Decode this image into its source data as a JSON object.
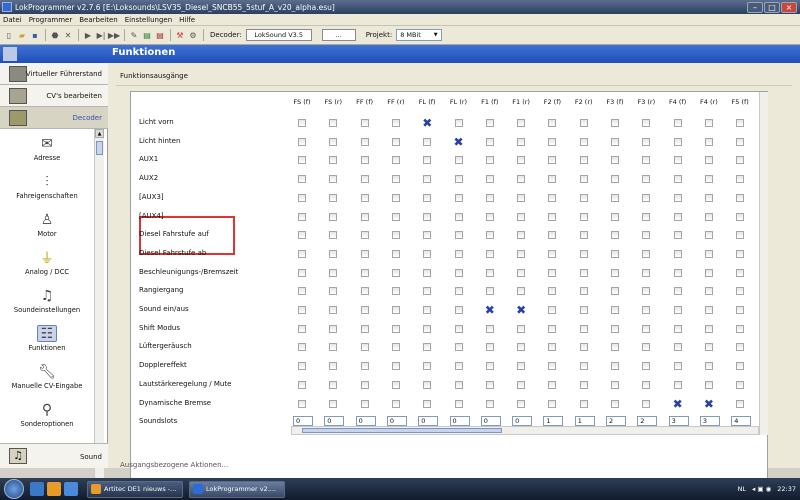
{
  "window": {
    "title": "LokProgrammer  v2.7.6  [E:\\Loksounds\\LSV35_Diesel_SNCB55_5stuf_A_v20_alpha.esu]"
  },
  "menu": [
    "Datei",
    "Programmer",
    "Bearbeiten",
    "Einstellungen",
    "Hilfe"
  ],
  "toolbar": {
    "decoder_label": "Decoder:",
    "decoder_value": "LokSound V3.5",
    "extra_field": "...",
    "projekt_label": "Projekt:",
    "projekt_value": "8 MBit"
  },
  "header": {
    "title": "Funktionen"
  },
  "sidebar": {
    "top": [
      {
        "label": "Virtueller Führerstand",
        "icon": "cab-icon"
      },
      {
        "label": "CV's bearbeiten",
        "icon": "cv-table-icon"
      },
      {
        "label": "Decoder",
        "icon": "decoder-icon"
      }
    ],
    "items": [
      {
        "label": "Adresse",
        "icon": "envelope-icon"
      },
      {
        "label": "Fahreigenschaften",
        "icon": "sliders-icon"
      },
      {
        "label": "Motor",
        "icon": "motor-icon"
      },
      {
        "label": "Analog / DCC",
        "icon": "analog-dcc-icon"
      },
      {
        "label": "Soundeinstellungen",
        "icon": "music-notes-icon"
      },
      {
        "label": "Funktionen",
        "icon": "functions-icon"
      },
      {
        "label": "Manuelle CV-Eingabe",
        "icon": "wrench-icon"
      },
      {
        "label": "Sonderoptionen",
        "icon": "special-options-icon"
      }
    ],
    "bottom": {
      "label": "Sound",
      "icon": "sound-icon"
    }
  },
  "main": {
    "group_title": "Funktionsausgänge",
    "bottom_text": "Ausgangsbezogene Aktionen...",
    "columns": [
      "FS (f)",
      "FS (r)",
      "FF (f)",
      "FF (r)",
      "FL (f)",
      "FL (r)",
      "F1 (f)",
      "F1 (r)",
      "F2 (f)",
      "F2 (r)",
      "F3 (f)",
      "F3 (r)",
      "F4 (f)",
      "F4 (r)",
      "F5 (f)"
    ],
    "rows": [
      {
        "label": "Licht vorn",
        "checked": [
          4
        ]
      },
      {
        "label": "Licht hinten",
        "checked": [
          5
        ]
      },
      {
        "label": "AUX1",
        "checked": []
      },
      {
        "label": "AUX2",
        "checked": []
      },
      {
        "label": "[AUX3]",
        "checked": []
      },
      {
        "label": "[AUX4]",
        "checked": []
      },
      {
        "label": "Diesel Fahrstufe auf",
        "checked": []
      },
      {
        "label": "Diesel Fahrstufe ab",
        "checked": []
      },
      {
        "label": "Beschleunigungs-/Bremszeit",
        "checked": []
      },
      {
        "label": "Rangiergang",
        "checked": []
      },
      {
        "label": "Sound ein/aus",
        "checked": [
          6,
          7
        ]
      },
      {
        "label": "Shift Modus",
        "checked": []
      },
      {
        "label": "Lüftergeräusch",
        "checked": []
      },
      {
        "label": "Dopplereffekt",
        "checked": []
      },
      {
        "label": "Lautstärkeregelung / Mute",
        "checked": []
      },
      {
        "label": "Dynamische Bremse",
        "checked": [
          12,
          13
        ]
      }
    ],
    "soundslots_label": "Soundslots",
    "soundslots": [
      "0",
      "0",
      "0",
      "0",
      "0",
      "0",
      "0",
      "0",
      "1",
      "1",
      "2",
      "2",
      "3",
      "3",
      "4"
    ]
  },
  "taskbar": {
    "tasks": [
      {
        "label": "Artitec DE1 nieuws -...",
        "active": false
      },
      {
        "label": "LokProgrammer  v2....",
        "active": true
      }
    ],
    "lang": "NL",
    "time": "22:37"
  }
}
